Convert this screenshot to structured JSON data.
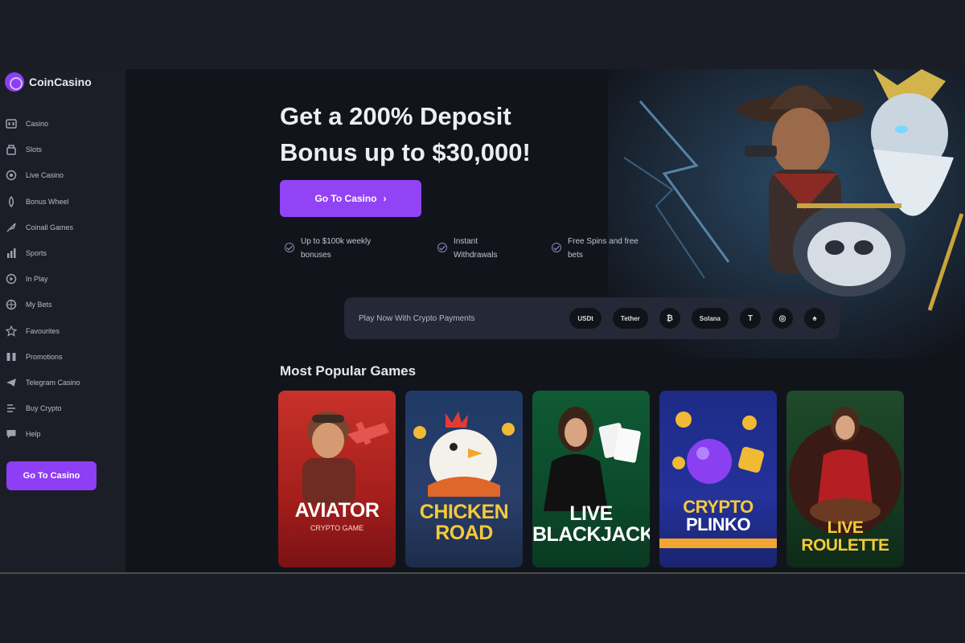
{
  "brand": {
    "name": "CoinCasino"
  },
  "sidebar": {
    "items": [
      {
        "label": "Casino",
        "icon": "slot-machine-icon"
      },
      {
        "label": "Slots",
        "icon": "cherry-icon"
      },
      {
        "label": "Live Casino",
        "icon": "dealer-icon"
      },
      {
        "label": "Bonus Wheel",
        "icon": "wheel-icon"
      },
      {
        "label": "Coinall Games",
        "icon": "rocket-icon"
      },
      {
        "label": "Sports",
        "icon": "trophy-icon"
      },
      {
        "label": "In Play",
        "icon": "play-icon"
      },
      {
        "label": "My Bets",
        "icon": "bets-icon"
      },
      {
        "label": "Favourites",
        "icon": "star-icon"
      },
      {
        "label": "Promotions",
        "icon": "gift-icon"
      },
      {
        "label": "Telegram Casino",
        "icon": "telegram-icon"
      },
      {
        "label": "Buy Crypto",
        "icon": "wallet-icon"
      },
      {
        "label": "Help",
        "icon": "chat-icon"
      }
    ],
    "cta_label": "Go To Casino"
  },
  "hero": {
    "title_line1": "Get a 200% Deposit",
    "title_line2": "Bonus up to $30,000!",
    "cta_label": "Go To Casino",
    "cta_arrow": "›",
    "perks": [
      {
        "line1": "Up to $100k weekly",
        "line2": "bonuses"
      },
      {
        "line1": "Instant",
        "line2": "Withdrawals"
      },
      {
        "line1": "Free Spins and free",
        "line2": "bets"
      }
    ]
  },
  "payments": {
    "label": "Play Now With Crypto Payments",
    "chips": [
      "USDt",
      "Tether",
      "₿",
      "Solana",
      "T",
      "◎",
      "♠"
    ]
  },
  "popular": {
    "title": "Most Popular Games",
    "games": [
      {
        "line1": "AVIATOR",
        "line2": "CRYPTO GAME"
      },
      {
        "line1": "CHICKEN",
        "line2": "ROAD"
      },
      {
        "line1": "LIVE",
        "line2": "BLACKJACK"
      },
      {
        "line1": "CRYPTO",
        "line2": "PLINKO"
      },
      {
        "line1": "LIVE",
        "line2": "ROULETTE"
      }
    ]
  },
  "colors": {
    "accent": "#9343f6",
    "sidebar_bg": "#1b1d27",
    "main_bg": "#12141b",
    "paybar_bg": "#252836"
  }
}
